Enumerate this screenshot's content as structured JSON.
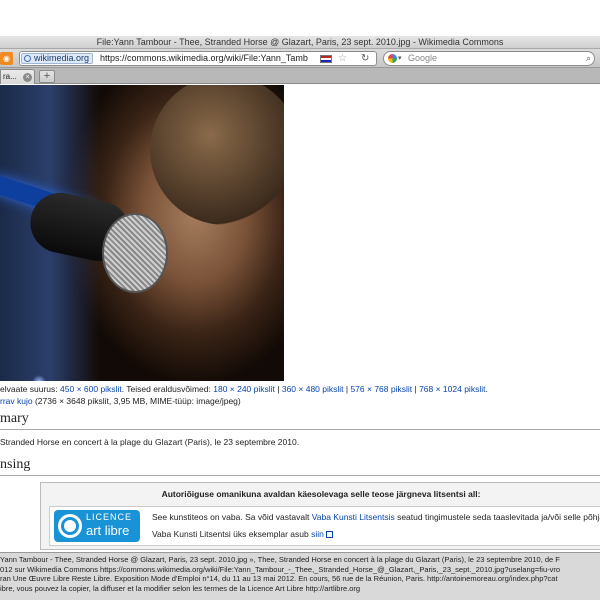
{
  "window": {
    "title": "File:Yann Tambour - Thee, Stranded Horse @ Glazart, Paris, 23 sept. 2010.jpg - Wikimedia Commons"
  },
  "navbar": {
    "site_badge": "wikimedia.org",
    "url": "https://commons.wikimedia.org/wiki/File:Yann_Tamb",
    "search_placeholder": "Google"
  },
  "tabs": [
    {
      "label": "ra..."
    }
  ],
  "newtab_label": "+",
  "resolutions": {
    "preview_prefix": "elvaate suurus:",
    "preview_size": "450 × 600 pikslit",
    "other_prefix": ". Teised eraldusvõimed:",
    "others": [
      "180 × 240 pikslit",
      "360 × 480 pikslit",
      "576 × 768 pikslit",
      "768 × 1024 pikslit"
    ],
    "separator": " | ",
    "suffix": ".",
    "original_link": "rrav kujo",
    "original_info": "(2736 × 3648 pikslit, 3,95 MB, MIME-tüüp: image/jpeg)"
  },
  "summary": {
    "heading": "mary",
    "text": "Stranded Horse en concert à la plage du Glazart (Paris), le 23 septembre 2010."
  },
  "licensing": {
    "heading": "nsing",
    "box_heading": "Autoriõiguse omanikuna avaldan käesolevaga selle teose järgneva litsentsi all:",
    "logo_top": "LICENCE",
    "logo_bottom": "art libre",
    "line1_prefix": "See kunstiteos on vaba. Sa võid vastavalt ",
    "line1_link": "Vaba Kunsti Litsentsis",
    "line1_suffix": " seatud tingimustele seda taaslevitada ja/või selle põhjal teise",
    "line2_prefix": "Vaba Kunsti Litsentsi üks eksemplar asub ",
    "line2_link": "siin"
  },
  "statusbar": {
    "lines": [
      "Yann Tambour - Thee, Stranded Horse @ Glazart, Paris, 23 sept. 2010.jpg », Thee, Stranded Horse en concert à la plage du Glazart (Paris), le 23 septembre 2010, de F",
      "012 sur Wikimedia Commons https://commons.wikimedia.org/wiki/File:Yann_Tambour_-_Thee,_Stranded_Horse_@_Glazart,_Paris,_23_sept._2010.jpg?uselang=fiu-vro",
      "ran Une Œuvre Libre Reste Libre. Exposition Mode d'Emploi n°14, du 11 au 13 mai 2012. En cours, 56 rue de la Réunion, Paris. http://antoinemoreau.org/index.php?cat",
      "ibre, vous pouvez la copier, la diffuser et la modifier selon les termes de la Licence Art Libre http://artlibre.org"
    ]
  }
}
